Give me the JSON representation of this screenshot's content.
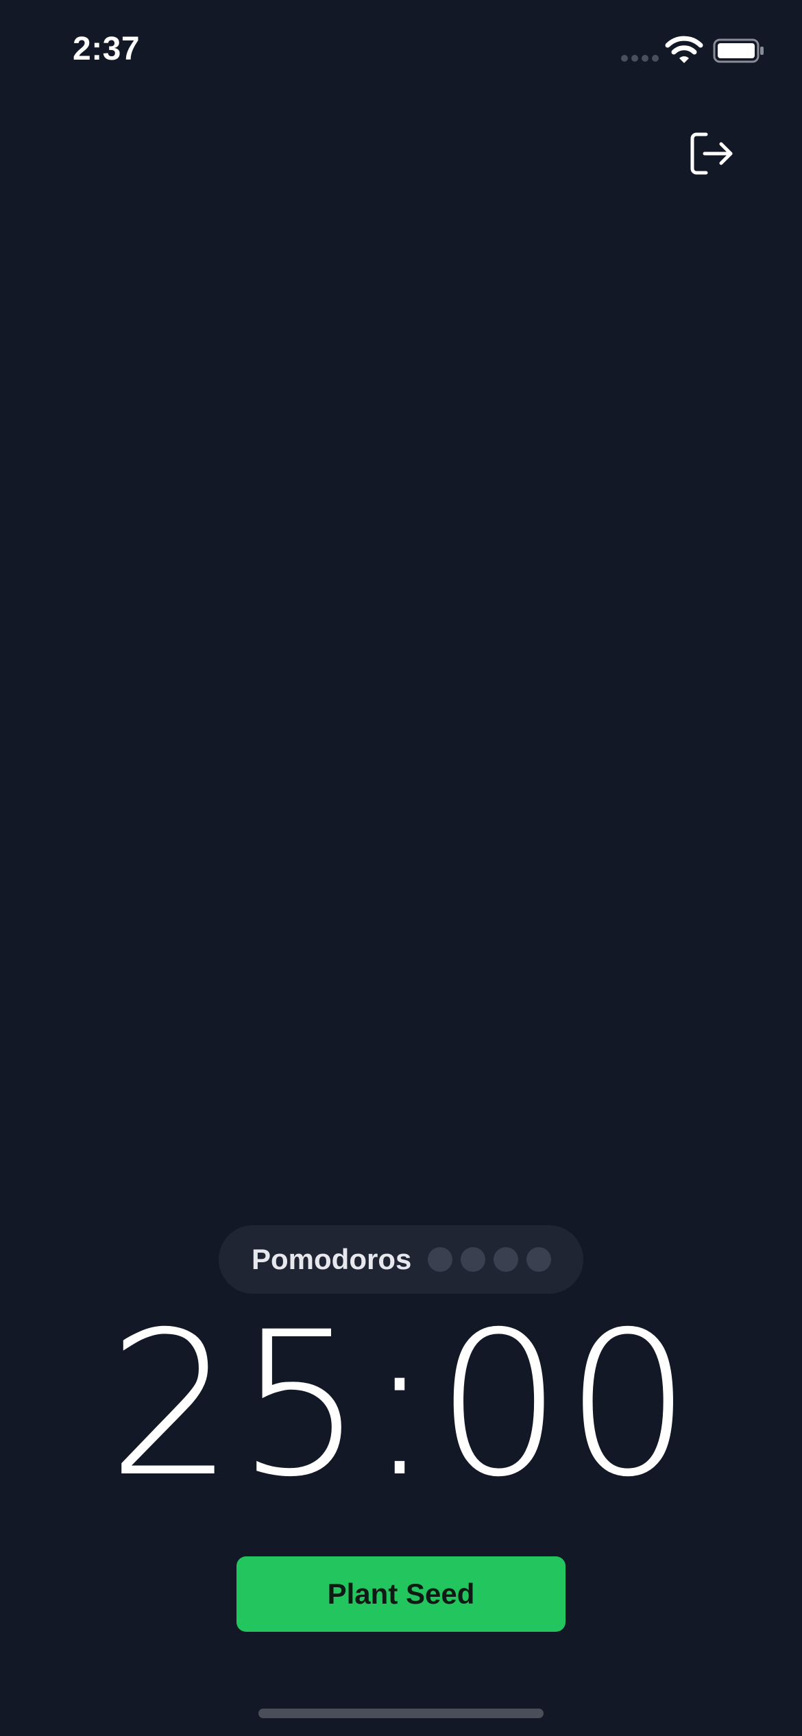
{
  "status_bar": {
    "time": "2:37",
    "icons": [
      "cellular-signal-icon",
      "wifi-icon",
      "battery-icon"
    ]
  },
  "header": {
    "logout_icon": "logout-icon"
  },
  "pomodoro": {
    "label": "Pomodoros",
    "completed": 0,
    "total": 4
  },
  "timer": {
    "display": "25:00"
  },
  "actions": {
    "plant_seed_label": "Plant Seed"
  },
  "colors": {
    "background": "#131826",
    "pill_background": "#1f2533",
    "dot_inactive": "#3a4050",
    "accent": "#22c55e",
    "text": "#ffffff"
  }
}
